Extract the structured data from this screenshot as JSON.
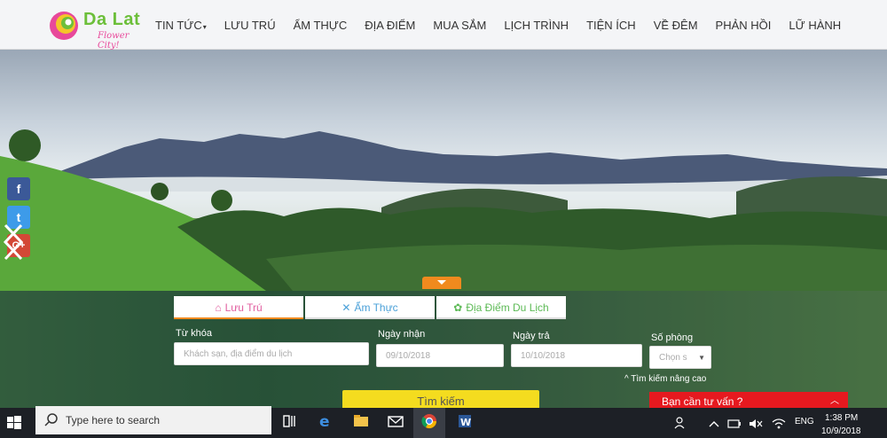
{
  "header": {
    "logo_title": "Da Lat",
    "logo_sub": "Flower City!",
    "nav": [
      {
        "label": "TIN TỨC",
        "has_caret": true
      },
      {
        "label": "LƯU TRÚ"
      },
      {
        "label": "ẨM THỰC"
      },
      {
        "label": "ĐỊA ĐIỂM"
      },
      {
        "label": "MUA SẮM"
      },
      {
        "label": "LỊCH TRÌNH"
      },
      {
        "label": "TIỆN ÍCH"
      },
      {
        "label": "VỀ ĐÊM"
      },
      {
        "label": "PHẢN HỒI"
      },
      {
        "label": "LỮ HÀNH"
      }
    ],
    "caret": "▾"
  },
  "social": {
    "facebook": "f",
    "twitter": "t",
    "google_plus": "G+"
  },
  "search": {
    "tabs": [
      {
        "label": "Lưu Trú",
        "icon": "house-icon"
      },
      {
        "label": "Ẩm Thực",
        "icon": "utensils-icon"
      },
      {
        "label": "Địa Điểm Du Lịch",
        "icon": "tree-icon"
      }
    ],
    "keyword_label": "Từ khóa",
    "keyword_placeholder": "Khách sạn, địa điểm du lịch",
    "checkin_label": "Ngày nhận",
    "checkin_value": "09/10/2018",
    "checkout_label": "Ngày trả",
    "checkout_value": "10/10/2018",
    "rooms_label": "Số phòng",
    "rooms_value": "Chọn s",
    "advanced": "Tìm kiếm nâng cao",
    "button": "Tìm kiếm",
    "consult": "Bạn cần tư vấn ?"
  },
  "taskbar": {
    "search_placeholder": "Type here to search",
    "tray_lang": "ENG",
    "time": "1:38 PM",
    "date": "10/9/2018"
  },
  "colors": {
    "accent_orange": "#f08a1e",
    "button_yellow": "#f4dc1f",
    "consult_red": "#e6191f",
    "logo_green": "#6cbf3a",
    "logo_pink": "#e8489a"
  }
}
